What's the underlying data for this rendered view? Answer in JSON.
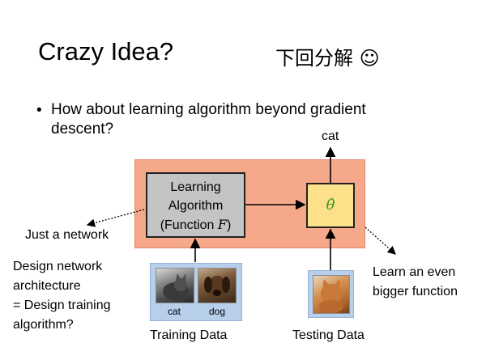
{
  "slide": {
    "title": "Crazy Idea?",
    "note": "下回分解 ☺",
    "bullet": "How about learning algorithm beyond gradient descent?"
  },
  "diagram": {
    "algorithm_line1": "Learning",
    "algorithm_line2": "Algorithm",
    "algorithm_line3_prefix": "(Function ",
    "algorithm_line3_var": "F",
    "algorithm_line3_suffix": ")",
    "model_symbol": "θ̂",
    "output_label": "cat",
    "left_callout": "Just a network",
    "right_callout_line1": "Learn an even",
    "right_callout_line2": "bigger function",
    "design_note_line1": "Design network",
    "design_note_line2": "architecture",
    "design_note_line3": "= Design training",
    "design_note_line4": "algorithm?",
    "training_caption": "Training Data",
    "testing_caption": "Testing Data",
    "train_cat_label": "cat",
    "train_dog_label": "dog"
  },
  "colors": {
    "panel": "#f5a98a",
    "algorithm_box": "#c4c4c4",
    "model_box": "#fde08a",
    "model_symbol": "#3a9a2a",
    "thumbnail_bg": "#b7cfea"
  }
}
